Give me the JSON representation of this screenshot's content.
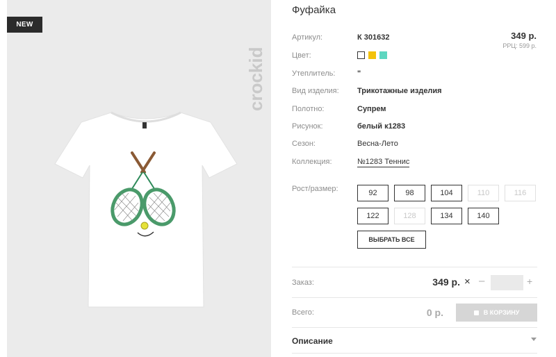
{
  "product": {
    "badge": "NEW",
    "brand": "crockid",
    "title": "Фуфайка"
  },
  "pricing": {
    "price": "349 р.",
    "rrp": "РРЦ: 599 р."
  },
  "specs": [
    {
      "label": "Артикул:",
      "value": "К 301632"
    },
    {
      "label": "Цвет:",
      "value": ""
    },
    {
      "label": "Утеплитель:",
      "value": "\""
    },
    {
      "label": "Вид изделия:",
      "value": "Трикотажные изделия"
    },
    {
      "label": "Полотно:",
      "value": "Супрем"
    },
    {
      "label": "Рисунок:",
      "value": "белый к1283"
    },
    {
      "label": "Сезон:",
      "value": "Весна-Лето"
    },
    {
      "label": "Коллекция:",
      "value": "№1283 Теннис"
    }
  ],
  "colors": [
    {
      "name": "white",
      "hex": "#ffffff",
      "selected": true
    },
    {
      "name": "yellow",
      "hex": "#f3c20c",
      "selected": false
    },
    {
      "name": "mint",
      "hex": "#5ed6c0",
      "selected": false
    }
  ],
  "sizes": {
    "label": "Рост/размер:",
    "options": [
      {
        "value": "92",
        "available": true
      },
      {
        "value": "98",
        "available": true
      },
      {
        "value": "104",
        "available": true
      },
      {
        "value": "110",
        "available": false
      },
      {
        "value": "116",
        "available": false
      },
      {
        "value": "122",
        "available": true
      },
      {
        "value": "128",
        "available": false
      },
      {
        "value": "134",
        "available": true
      },
      {
        "value": "140",
        "available": true
      }
    ],
    "select_all": "ВЫБРАТЬ ВСЕ"
  },
  "order": {
    "label": "Заказ:",
    "price": "349 р.",
    "times": "×",
    "minus": "–",
    "plus": "+",
    "quantity": ""
  },
  "total": {
    "label": "Всего:",
    "value": "0 р.",
    "cart_button": "В КОРЗИНУ"
  },
  "description": {
    "title": "Описание"
  }
}
